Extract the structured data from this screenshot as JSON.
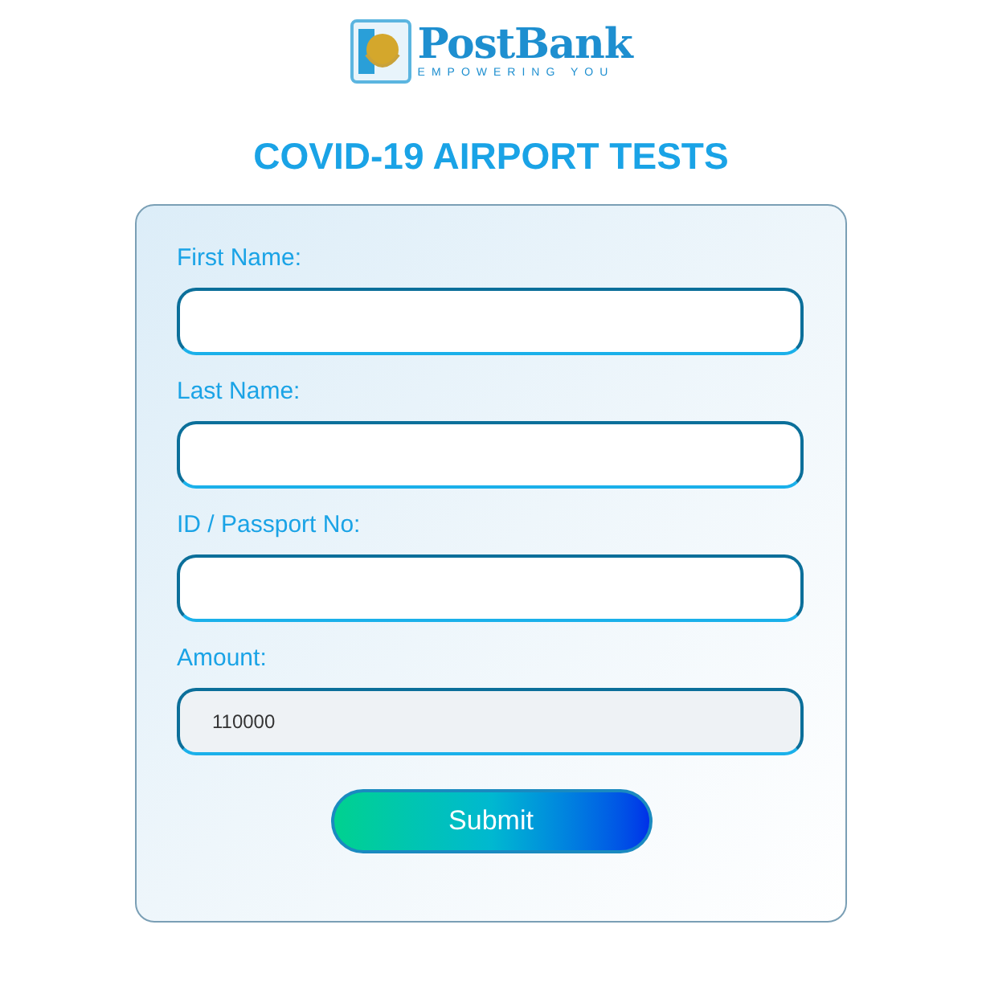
{
  "logo": {
    "name": "PostBank",
    "tagline": "EMPOWERING YOU"
  },
  "title": "COVID-19 AIRPORT TESTS",
  "form": {
    "fields": [
      {
        "label": "First Name:",
        "readonly": false
      },
      {
        "label": "Last Name:",
        "readonly": false
      },
      {
        "label": "ID / Passport No:",
        "readonly": false
      },
      {
        "label": "Amount:",
        "value": "110000",
        "readonly": true
      }
    ],
    "submit": "Submit"
  }
}
